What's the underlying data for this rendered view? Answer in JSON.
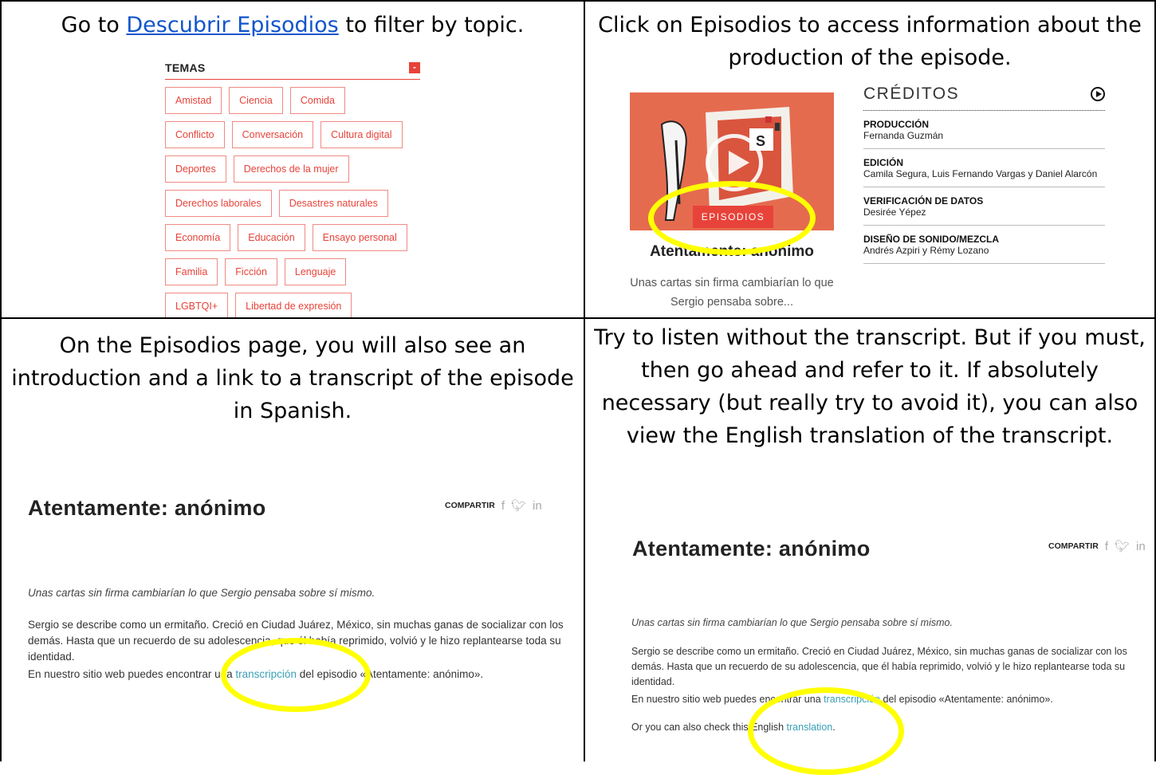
{
  "cell1": {
    "instruction_prefix": "Go to ",
    "instruction_link": "Descubrir Episodios",
    "instruction_suffix": " to filter by topic.",
    "temas": {
      "title": "TEMAS",
      "toggle": "-",
      "rows": [
        [
          "Amistad",
          "Ciencia",
          "Comida"
        ],
        [
          "Conflicto",
          "Conversación",
          "Cultura digital"
        ],
        [
          "Deportes",
          "Derechos de la mujer"
        ],
        [
          "Derechos laborales",
          "Desastres naturales"
        ],
        [
          "Economía",
          "Educación",
          "Ensayo personal"
        ],
        [
          "Familia",
          "Ficción",
          "Lenguaje"
        ],
        [
          "LGBTQI+",
          "Libertad de expresión"
        ]
      ]
    }
  },
  "cell2": {
    "instruction": "Click on Episodios to access information about the production of the episode.",
    "episode": {
      "badge": "EPISODIOS",
      "title": "Atentamente: anónimo",
      "description": "Unas cartas sin firma cambiarían lo que Sergio pensaba sobre..."
    },
    "credits": {
      "heading": "CRÉDITOS",
      "items": [
        {
          "role": "PRODUCCIÓN",
          "name": "Fernanda Guzmán"
        },
        {
          "role": "EDICIÓN",
          "name": "Camila Segura, Luis Fernando Vargas y Daniel Alarcón"
        },
        {
          "role": "VERIFICACIÓN DE DATOS",
          "name": "Desirée Yépez"
        },
        {
          "role": "DISEÑO DE SONIDO/MEZCLA",
          "name": "Andrés Azpiri y Rémy Lozano"
        }
      ]
    }
  },
  "cell3": {
    "instruction": "On the Episodios page, you will also see an introduction and a link to a transcript of the episode in Spanish.",
    "page_title": "Atentamente: anónimo",
    "share_label": "COMPARTIR",
    "social_icons": [
      "facebook-icon",
      "twitter-icon",
      "linkedin-icon"
    ],
    "intro": "Unas cartas sin firma cambiarían lo que Sergio pensaba sobre sí mismo.",
    "body": "Sergio se describe como un ermitaño. Creció en Ciudad Juárez, México, sin muchas ganas de socializar con los demás. Hasta que un recuerdo de su adolescencia, que él había reprimido, volvió y le hizo replantearse toda su identidad.",
    "transcript_prefix": "En nuestro sitio web puedes encontrar una ",
    "transcript_link": "transcripción",
    "transcript_suffix": " del episodio «Atentamente: anónimo»."
  },
  "cell4": {
    "instruction": "Try to listen without the transcript. But if you must, then go ahead and refer to it. If absolutely necessary (but really try to avoid it), you can also view the English translation of the transcript.",
    "page_title": "Atentamente: anónimo",
    "share_label": "COMPARTIR",
    "intro": "Unas cartas sin firma cambiarían lo que Sergio pensaba sobre sí mismo.",
    "body": "Sergio se describe como un ermitaño. Creció en Ciudad Juárez, México, sin muchas ganas de socializar con los demás. Hasta que un recuerdo de su adolescencia, que él había reprimido, volvió y le hizo replantearse toda su identidad.",
    "transcript_prefix": "En nuestro sitio web puedes encontrar una ",
    "transcript_link": "transcripción",
    "transcript_suffix": " del episodio «Atentamente: anónimo».",
    "translation_prefix": "Or you can also check this English ",
    "translation_link": "translation",
    "translation_suffix": "."
  },
  "colors": {
    "accent_red": "#e8433a",
    "highlight_yellow": "#ffff00",
    "link_teal": "#3aa0b5",
    "hyperlink_blue": "#1155cc"
  }
}
